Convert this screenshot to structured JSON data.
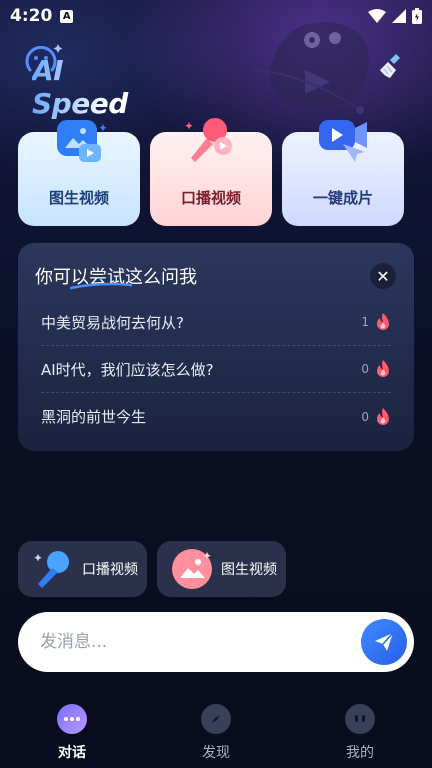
{
  "status_bar": {
    "time": "4:20",
    "badge": "A"
  },
  "header": {
    "logo": "AI Speed"
  },
  "feature_cards": [
    {
      "label": "图生视频"
    },
    {
      "label": "口播视频"
    },
    {
      "label": "一键成片"
    }
  ],
  "suggestions": {
    "title": "你可以尝试这么问我",
    "close": "✕",
    "items": [
      {
        "text": "中美贸易战何去何从?",
        "count": "1"
      },
      {
        "text": "AI时代，我们应该怎么做?",
        "count": "0"
      },
      {
        "text": "黑洞的前世今生",
        "count": "0"
      }
    ]
  },
  "quick_actions": [
    {
      "label": "口播视频"
    },
    {
      "label": "图生视频"
    }
  ],
  "composer": {
    "placeholder": "发消息..."
  },
  "bottom_nav": [
    {
      "label": "对话",
      "active": true
    },
    {
      "label": "发现",
      "active": false
    },
    {
      "label": "我的",
      "active": false
    }
  ],
  "colors": {
    "accent": "#3d8bff",
    "background": "#0b1024",
    "flame": "#ff5a6e"
  }
}
